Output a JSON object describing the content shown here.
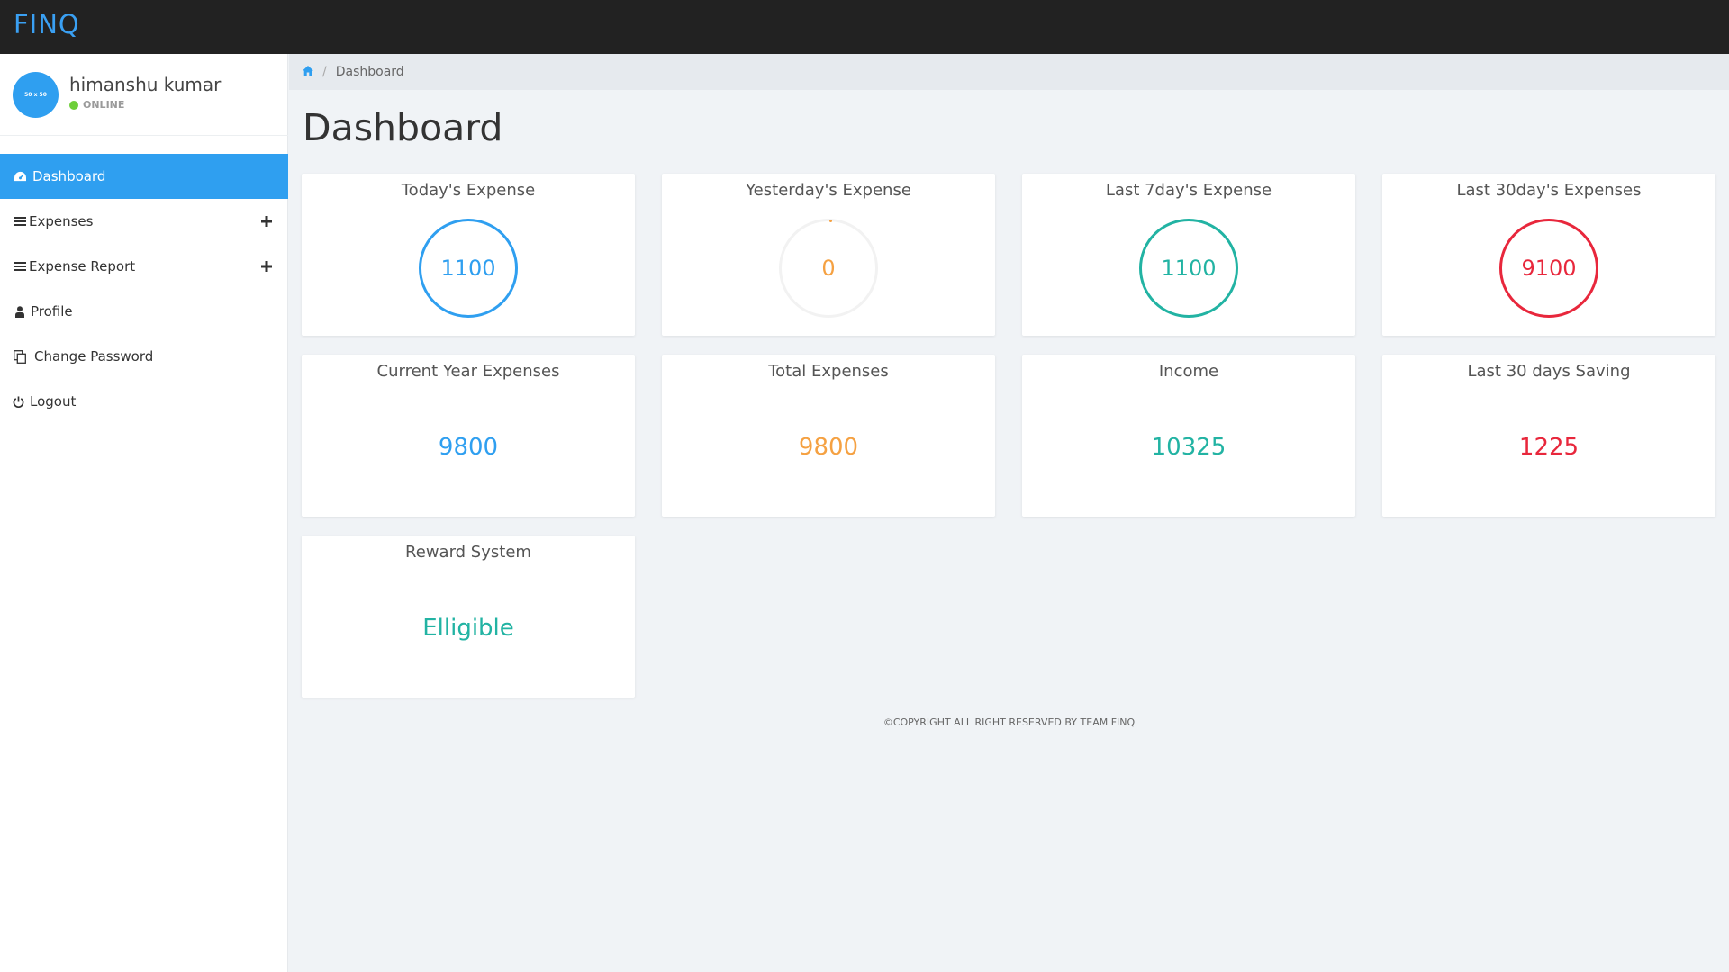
{
  "app": {
    "brand": "FINQ"
  },
  "user": {
    "name": "himanshu kumar",
    "status": "ONLINE",
    "avatar_text": "50 x 50"
  },
  "sidebar": {
    "items": [
      {
        "label": "Dashboard",
        "icon": "dashboard-icon"
      },
      {
        "label": "Expenses",
        "icon": "bars-icon"
      },
      {
        "label": "Expense Report",
        "icon": "bars-icon"
      },
      {
        "label": "Profile",
        "icon": "user-icon"
      },
      {
        "label": "Change Password",
        "icon": "copy-icon"
      },
      {
        "label": "Logout",
        "icon": "power-icon"
      }
    ]
  },
  "breadcrumb": {
    "current": "Dashboard"
  },
  "page": {
    "title": "Dashboard"
  },
  "cards": [
    {
      "title": "Today's Expense",
      "value": "1100",
      "color": "#2f9ff0"
    },
    {
      "title": "Yesterday's Expense",
      "value": "0",
      "color": "#f5a142"
    },
    {
      "title": "Last 7day's Expense",
      "value": "1100",
      "color": "#22b3a3"
    },
    {
      "title": "Last 30day's Expenses",
      "value": "9100",
      "color": "#e8273c"
    },
    {
      "title": "Current Year Expenses",
      "value": "9800",
      "color": "#2f9ff0"
    },
    {
      "title": "Total Expenses",
      "value": "9800",
      "color": "#f5a142"
    },
    {
      "title": "Income",
      "value": "10325",
      "color": "#22b3a3"
    },
    {
      "title": "Last 30 days Saving",
      "value": "1225",
      "color": "#e8273c"
    },
    {
      "title": "Reward System",
      "value": "Elligible",
      "color": "#22b3a3"
    }
  ],
  "footer": {
    "text": "©COPYRIGHT ALL RIGHT RESERVED BY TEAM FINQ"
  }
}
